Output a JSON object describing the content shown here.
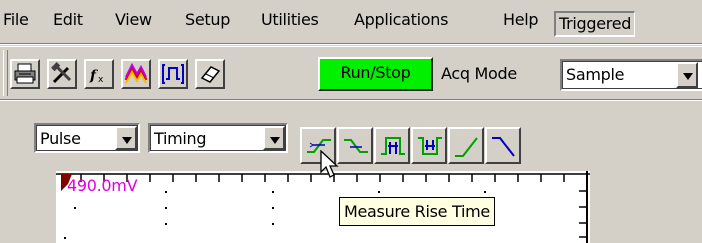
{
  "menu": {
    "items": [
      "File",
      "Edit",
      "View",
      "Setup",
      "Utilities",
      "Applications",
      "Help"
    ],
    "status": "Triggered"
  },
  "toolbar": {
    "buttons": [
      "print-icon",
      "hammer-wrench-icon",
      "fx-math-icon",
      "color-waveform-icon",
      "pulse-bracket-icon",
      "eraser-icon"
    ],
    "run_stop_label": "Run/Stop",
    "run_stop_color": "#00f000",
    "acq_mode_label": "Acq Mode",
    "acq_mode_value": "Sample"
  },
  "measure_bar": {
    "category_value": "Pulse",
    "group_value": "Timing",
    "buttons": [
      "rise-time-icon",
      "fall-time-icon",
      "positive-width-icon",
      "negative-width-icon",
      "rising-edge-icon",
      "falling-edge-icon"
    ]
  },
  "display": {
    "ref_level": "490.0mV",
    "ref_color": "#e000e0"
  },
  "tooltip": {
    "text": "Measure Rise Time"
  }
}
